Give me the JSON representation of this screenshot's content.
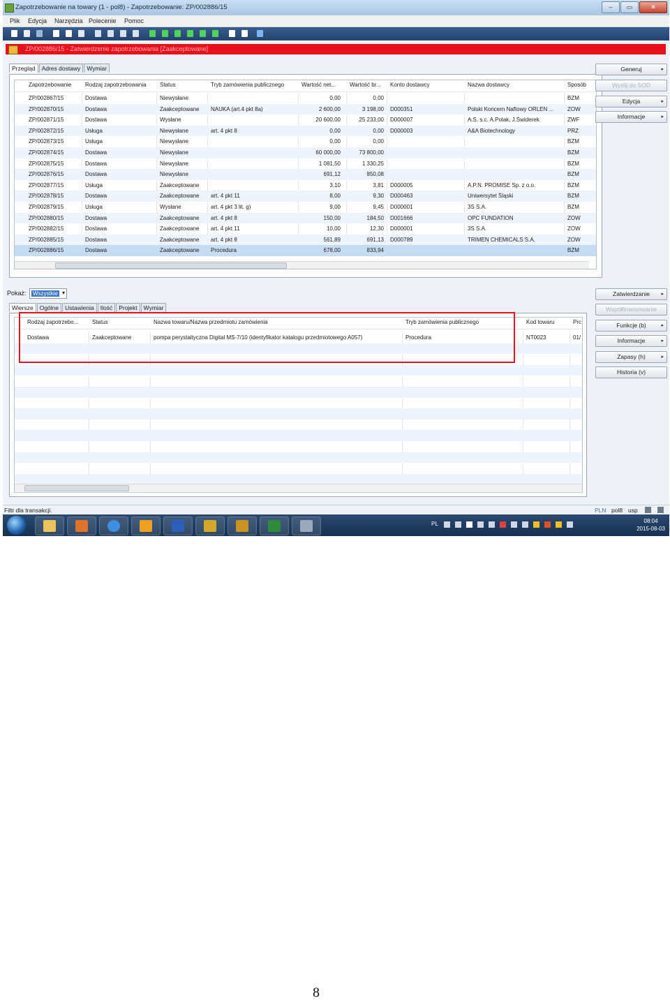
{
  "window": {
    "title": "Zapotrzebowanie na towary (1 - pol8) - Zapotrzebowanie: ZP/002886/15",
    "buttons": [
      "–",
      "▭",
      "✕"
    ]
  },
  "menu": [
    "Plik",
    "Edycja",
    "Narzędzia",
    "Polecenie",
    "Pomoc"
  ],
  "banner": {
    "text": "ZP/002886/15 - Zatwierdzenie zapotrzebowania [Zaakceptowane]"
  },
  "top_tabs": [
    "Przegląd",
    "Adres dostawy",
    "Wymiar"
  ],
  "top_grid": {
    "columns": [
      "Zapotrzebowanie",
      "Rodzaj zapotrzebowania",
      "Status",
      "Tryb zamówienia publicznego",
      "Wartość net...",
      "Wartość br...",
      "Konto dostawcy",
      "Nazwa dostawcy",
      "Sposób"
    ],
    "rows": [
      [
        "ZP/002867/15",
        "Dostawa",
        "Niewysłane",
        "",
        "0,00",
        "0,00",
        "",
        "",
        "BZM"
      ],
      [
        "ZP/002870/15",
        "Dostawa",
        "Zaakceptowane",
        "NAUKA (art.4 pkt 8a)",
        "2 600,00",
        "3 198,00",
        "D000351",
        "Polski Koncern Naftowy ORLEN ...",
        "ZOW"
      ],
      [
        "ZP/002871/15",
        "Dostawa",
        "Wysłane",
        "",
        "20 600,00",
        "25 233,00",
        "D000007",
        "A.S. s.c. A.Polak, J.Świderek",
        "ZWF"
      ],
      [
        "ZP/002872/15",
        "Usługa",
        "Niewysłane",
        "art. 4 pkt 8",
        "0,00",
        "0,00",
        "D000003",
        "A&A Biotechnology",
        "PRZ"
      ],
      [
        "ZP/002873/15",
        "Usługa",
        "Niewysłane",
        "",
        "0,00",
        "0,00",
        "",
        "",
        "BZM"
      ],
      [
        "ZP/002874/15",
        "Dostawa",
        "Niewysłane",
        "",
        "60 000,00",
        "73 800,00",
        "",
        "",
        "BZM"
      ],
      [
        "ZP/002875/15",
        "Dostawa",
        "Niewysłane",
        "",
        "1 081,50",
        "1 330,25",
        "",
        "",
        "BZM"
      ],
      [
        "ZP/002876/15",
        "Dostawa",
        "Niewysłane",
        "",
        "691,12",
        "850,08",
        "",
        "",
        "BZM"
      ],
      [
        "ZP/002877/15",
        "Usługa",
        "Zaakceptowane",
        "",
        "3,10",
        "3,81",
        "D000005",
        "A.P.N. PROMISE Sp. z o.o.",
        "BZM"
      ],
      [
        "ZP/002878/15",
        "Dostawa",
        "Zaakceptowane",
        "art. 4 pkt 11",
        "8,00",
        "9,30",
        "D000463",
        "Uniwersytet Śląski",
        "BZM"
      ],
      [
        "ZP/002879/15",
        "Usługa",
        "Wysłane",
        "art. 4 pkt 3 lit. g)",
        "9,00",
        "9,45",
        "D000001",
        "3S S.A.",
        "BZM"
      ],
      [
        "ZP/002880/15",
        "Dostawa",
        "Zaakceptowane",
        "art. 4 pkt 8",
        "150,00",
        "184,50",
        "D001666",
        "OPC FUNDATION",
        "ZOW"
      ],
      [
        "ZP/002882/15",
        "Dostawa",
        "Zaakceptowane",
        "art. 4 pkt 11",
        "10,00",
        "12,30",
        "D000001",
        "3S S.A.",
        "ZOW"
      ],
      [
        "ZP/002885/15",
        "Dostawa",
        "Zaakceptowane",
        "art. 4 pkt 8",
        "561,89",
        "691,13",
        "D000789",
        "TRIMEN CHEMICALS S.A.",
        "ZOW"
      ],
      [
        "ZP/002886/15",
        "Dostawa",
        "Zaakceptowane",
        "Procedura",
        "678,00",
        "833,94",
        "",
        "",
        "BZM"
      ]
    ],
    "selected_row": 14
  },
  "right_buttons_top": [
    {
      "label": "Generuj",
      "arrow": "▸",
      "enabled": true
    },
    {
      "label": "Wyślij do SOD",
      "arrow": "",
      "enabled": false
    },
    {
      "label": "Edycja",
      "arrow": "▸",
      "enabled": true
    },
    {
      "label": "Informacje",
      "arrow": "▸",
      "enabled": true
    }
  ],
  "pokaz": {
    "label": "Pokaż:",
    "value": "Wszystkie",
    "arrow": "▾"
  },
  "bottom_tabs": [
    "Wiersze",
    "Ogólne",
    "Ustawienia",
    "Ilość",
    "Projekt",
    "Wymiar"
  ],
  "bottom_grid": {
    "columns": [
      "Rodzaj zapotrzebo...",
      "Status",
      "Nazwa towaru/Nazwa przedmiotu zamówienia",
      "Tryb zamówienia publicznego",
      "Kod towaru",
      "Prc"
    ],
    "rows": [
      [
        "Dostawa",
        "Zaakceptowane",
        "pompa perystaltyczna Digital MS-7/10 (identyfikator katalogu przedmiotowego A057)",
        "Procedura",
        "NT0023",
        "01/"
      ]
    ]
  },
  "right_buttons_bottom": [
    {
      "label": "Zatwierdzanie",
      "arrow": "▸",
      "enabled": true
    },
    {
      "label": "Współfinansowanie",
      "arrow": "",
      "enabled": false
    },
    {
      "label": "Funkcje (b)",
      "arrow": "▸",
      "enabled": true
    },
    {
      "label": "Informacje",
      "arrow": "▸",
      "enabled": true
    },
    {
      "label": "Zapasy (h)",
      "arrow": "▸",
      "enabled": true
    },
    {
      "label": "Historia (v)",
      "arrow": "",
      "enabled": true
    }
  ],
  "statusbar": {
    "left": "Filtr dla transakcji.",
    "right": [
      "PLN",
      "pol8",
      "usp"
    ]
  },
  "tray": {
    "lang": "PL",
    "time": "08:04",
    "date": "2015-08-03"
  },
  "page_number": "8",
  "colors": {
    "banner": "#e8101b",
    "highlight_box": "#e1141c",
    "selection": "#c6dcf2"
  }
}
